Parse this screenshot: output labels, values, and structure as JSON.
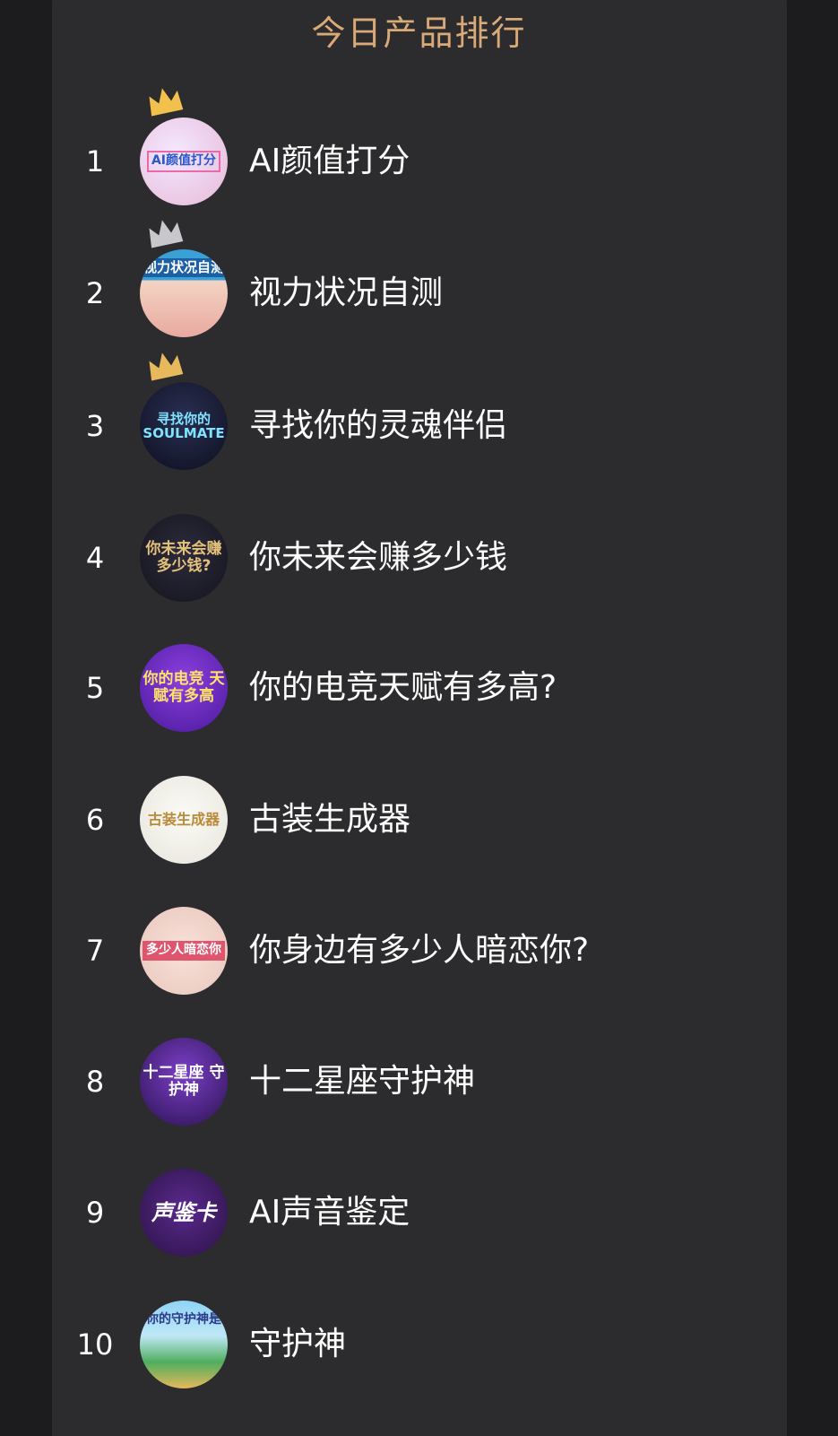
{
  "header": {
    "title": "今日产品排行"
  },
  "rankings": [
    {
      "rank": "1",
      "name": "AI颜值打分",
      "thumb_text": "AI颜值打分",
      "crown": "gold-crown-icon"
    },
    {
      "rank": "2",
      "name": "视力状况自测",
      "thumb_text": "视力状况自测",
      "crown": "silver-crown-icon"
    },
    {
      "rank": "3",
      "name": "寻找你的灵魂伴侣",
      "thumb_text": "寻找你的 SOULMATE",
      "crown": "bronze-crown-icon"
    },
    {
      "rank": "4",
      "name": "你未来会赚多少钱",
      "thumb_text": "你未来会赚 多少钱?"
    },
    {
      "rank": "5",
      "name": "你的电竞天赋有多高?",
      "thumb_text": "你的电竞 天赋有多高"
    },
    {
      "rank": "6",
      "name": "古装生成器",
      "thumb_text": "古装生成器"
    },
    {
      "rank": "7",
      "name": "你身边有多少人暗恋你?",
      "thumb_text": "多少人暗恋你"
    },
    {
      "rank": "8",
      "name": "十二星座守护神",
      "thumb_text": "十二星座 守护神"
    },
    {
      "rank": "9",
      "name": "AI声音鉴定",
      "thumb_text": "声鉴卡"
    },
    {
      "rank": "10",
      "name": "守护神",
      "thumb_text": "你的守护神是"
    }
  ],
  "colors": {
    "title": "#d9a978",
    "panel": "#2c2c2e",
    "background": "#1c1c1e",
    "gold": "#f2c04d",
    "silver": "#c8c8cc",
    "bronze": "#e8b85c"
  }
}
